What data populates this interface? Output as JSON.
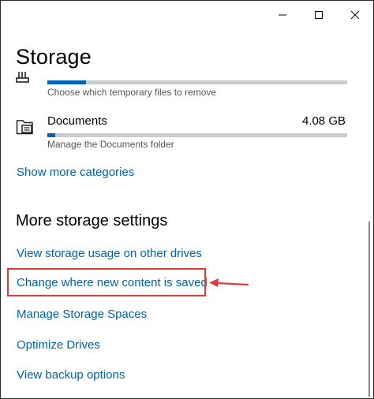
{
  "window": {
    "title": "Storage",
    "controls": {
      "minimize_icon": "minimize-icon",
      "maximize_icon": "maximize-icon",
      "close_icon": "close-icon"
    }
  },
  "categories": [
    {
      "icon": "temporary-files-icon",
      "name": "",
      "size": "",
      "fill_fraction": 0.13,
      "description": "Choose which temporary files to remove"
    },
    {
      "icon": "documents-folder-icon",
      "name": "Documents",
      "size": "4.08 GB",
      "fill_fraction": 0.025,
      "description": "Manage the Documents folder"
    }
  ],
  "show_more_label": "Show more categories",
  "more_settings": {
    "title": "More storage settings",
    "links": [
      "View storage usage on other drives",
      "Change where new content is saved",
      "Manage Storage Spaces",
      "Optimize Drives",
      "View backup options"
    ],
    "highlighted_index": 1
  },
  "colors": {
    "accent": "#0063b1",
    "highlight": "#e03a3a",
    "bar_track": "#cccccc"
  }
}
